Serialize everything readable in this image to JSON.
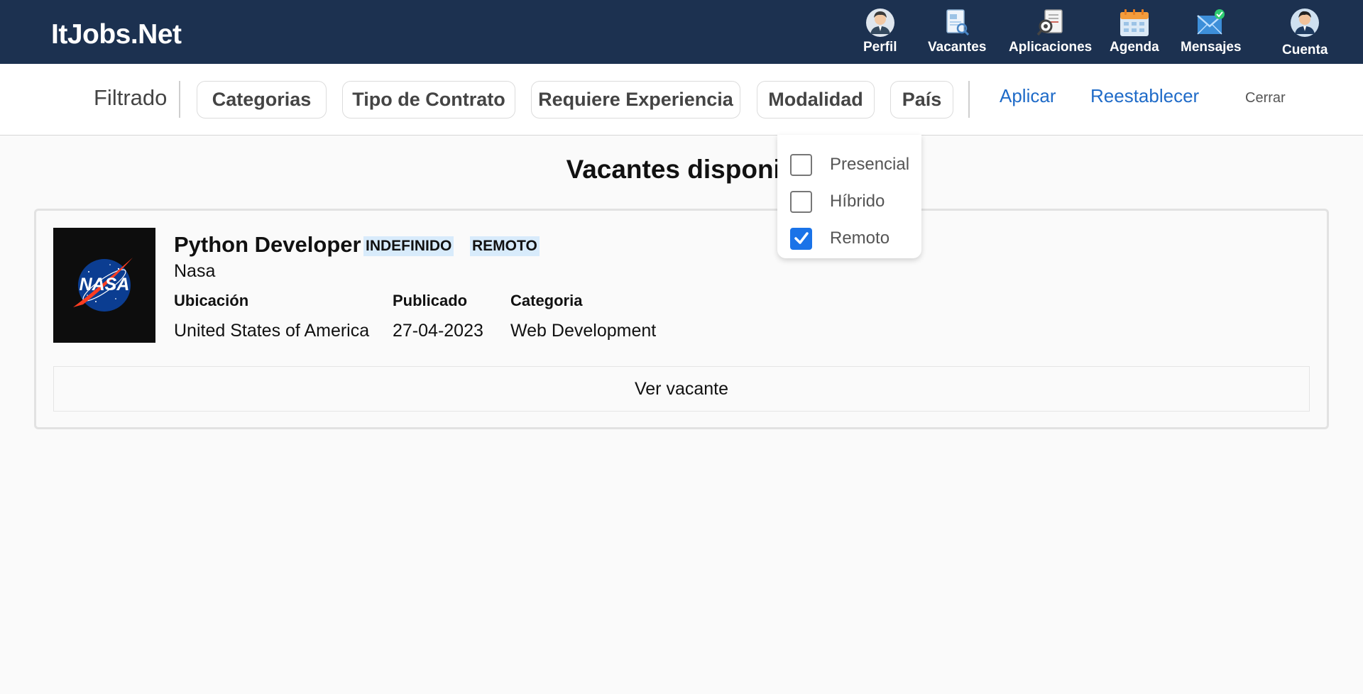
{
  "navbar": {
    "brand": "ItJobs.Net",
    "items": [
      {
        "label": "Perfil",
        "icon": "profile-avatar-icon"
      },
      {
        "label": "Vacantes",
        "icon": "document-search-icon"
      },
      {
        "label": "Aplicaciones",
        "icon": "applications-search-icon"
      },
      {
        "label": "Agenda",
        "icon": "calendar-icon"
      },
      {
        "label": "Mensajes",
        "icon": "mail-check-icon"
      },
      {
        "label": "Cuenta",
        "icon": "account-avatar-icon"
      }
    ],
    "background": "#1c3150"
  },
  "filters": {
    "title": "Filtrado",
    "chips": [
      "Categorias",
      "Tipo de Contrato",
      "Requiere Experiencia",
      "Modalidad",
      "País"
    ],
    "apply": "Aplicar",
    "reset": "Reestablecer",
    "close": "Cerrar",
    "link_color": "#1f6bc8"
  },
  "modalidad_dropdown": {
    "options": [
      {
        "label": "Presencial",
        "checked": false
      },
      {
        "label": "Híbrido",
        "checked": false
      },
      {
        "label": "Remoto",
        "checked": true
      }
    ],
    "check_color": "#1a73e8"
  },
  "main": {
    "heading": "Vacantes disponib",
    "jobs": [
      {
        "title": "Python Developer",
        "tags": [
          "INDEFINIDO",
          "REMOTO"
        ],
        "company": "Nasa",
        "logo_text": "NASA",
        "fields": [
          {
            "label": "Ubicación",
            "value": "United States of America"
          },
          {
            "label": "Publicado",
            "value": "27-04-2023"
          },
          {
            "label": "Categoria",
            "value": "Web Development"
          }
        ],
        "action": "Ver vacante"
      }
    ]
  }
}
